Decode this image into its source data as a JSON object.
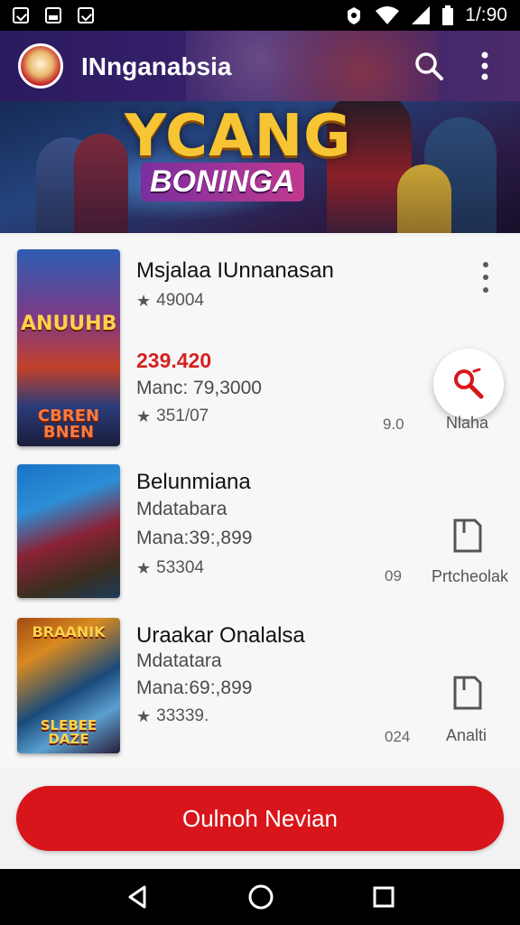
{
  "status_bar": {
    "time": "1/:90",
    "left_icons": [
      "download-box-icon",
      "image-icon",
      "checkbox-icon"
    ],
    "right_icons": [
      "vpn-key-icon",
      "wifi-icon",
      "signal-icon",
      "battery-icon"
    ]
  },
  "app_bar": {
    "title": "INnganabsia",
    "actions": [
      "search-icon",
      "more-vert-icon"
    ]
  },
  "banner": {
    "title": "YCANG",
    "subtitle": "BONINGA"
  },
  "items": [
    {
      "title": "Msjalaa IUnnanasan",
      "rating": "49004",
      "price": "239.420",
      "meta": "Manc: 79,3000",
      "rating2": "351/07",
      "small_number": "9.0",
      "action_label": "Nlaha",
      "thumb_caption_top": "ANUUHB",
      "thumb_caption_bottom": "CBREN\nBNEN"
    },
    {
      "title": "Belunmiana",
      "subtitle": "Mdatabara",
      "meta": "Mana:39:,899",
      "rating": "53304",
      "small_number": "09",
      "action_label": "Prtcheolak"
    },
    {
      "title": "Uraakar Onalalsa",
      "subtitle": "Mdatatara",
      "meta": "Mana:69:,899",
      "rating": "33339.",
      "small_number": "024",
      "action_label": "Analti",
      "thumb_caption_top": "BRAANIK",
      "thumb_caption_bottom": "SLEBEE DAZE"
    }
  ],
  "bottom_button": {
    "label": "Oulnoh Nevian"
  },
  "nav_bar": [
    "back-icon",
    "home-icon",
    "recents-icon"
  ],
  "colors": {
    "accent": "#d8151b",
    "app_bar": "#2b1a5f",
    "price": "#d32222"
  }
}
